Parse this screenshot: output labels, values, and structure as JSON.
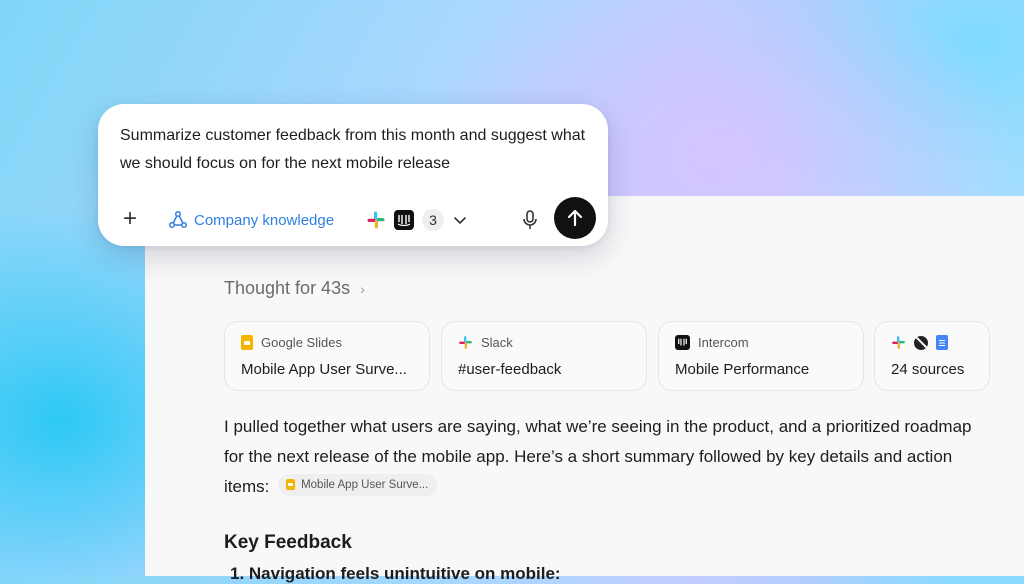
{
  "composer": {
    "prompt": "Summarize customer feedback from this month and suggest what we should focus on for the next mobile release",
    "add_label": "+",
    "knowledge_label": "Company knowledge",
    "connectors_count": "3"
  },
  "response": {
    "thought_label": "Thought for 43s",
    "sources": [
      {
        "source": "Google Slides",
        "title": "Mobile App User Surve...",
        "icon": "google-slides-icon"
      },
      {
        "source": "Slack",
        "title": "#user-feedback",
        "icon": "slack-icon"
      },
      {
        "source": "Intercom",
        "title": "Mobile Performance",
        "icon": "intercom-icon"
      },
      {
        "source": "",
        "title": "24 sources",
        "icon": "more-sources-icons"
      }
    ],
    "paragraph": "I pulled together what users are saying, what we’re seeing in the product, and a prioritized roadmap for the next release of the mobile app. Here’s a short summary followed by key details and action items:",
    "chip_label": "Mobile App User Surve...",
    "heading": "Key Feedback",
    "list_item_1": "1.  Navigation feels unintuitive on mobile:"
  },
  "colors": {
    "accent": "#2f7fe0",
    "send_button": "#111111",
    "slides_yellow": "#f4b400",
    "docs_blue": "#4285f4"
  }
}
